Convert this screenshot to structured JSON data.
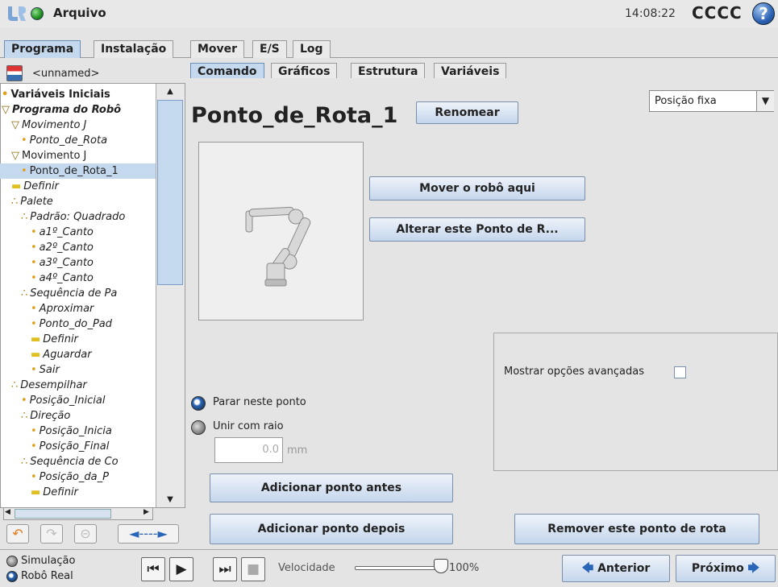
{
  "topbar": {
    "app_title": "Arquivo",
    "clock": "14:08:22",
    "robot_name": "CCCC",
    "help": "?"
  },
  "main_tabs": [
    "Programa",
    "Instalação",
    "Mover",
    "E/S",
    "Log"
  ],
  "sub_tabs": [
    "Comando",
    "Gráficos",
    "Estrutura",
    "Variáveis"
  ],
  "file": {
    "name": "<unnamed>"
  },
  "tree": [
    {
      "label": "Variáveis Iniciais",
      "style": "bold",
      "indent": 0,
      "marker": "•"
    },
    {
      "label": "Programa do Robô",
      "style": "bold-ital",
      "indent": 0,
      "marker": "▽"
    },
    {
      "label": "Movimento J",
      "style": "ital",
      "indent": 1,
      "marker": "▽"
    },
    {
      "label": "Ponto_de_Rota",
      "style": "ital",
      "indent": 2,
      "marker": "•"
    },
    {
      "label": "Movimento J",
      "style": "",
      "indent": 1,
      "marker": "▽"
    },
    {
      "label": "Ponto_de_Rota_1",
      "style": "sel",
      "indent": 2,
      "marker": "•"
    },
    {
      "label": "Definir",
      "style": "ital",
      "indent": 1,
      "marker": "▬"
    },
    {
      "label": "Palete",
      "style": "ital",
      "indent": 1,
      "marker": "∴"
    },
    {
      "label": "Padrão: Quadrado",
      "style": "ital",
      "indent": 2,
      "marker": "∴"
    },
    {
      "label": "a1º_Canto",
      "style": "ital",
      "indent": 3,
      "marker": "•"
    },
    {
      "label": "a2º_Canto",
      "style": "ital",
      "indent": 3,
      "marker": "•"
    },
    {
      "label": "a3º_Canto",
      "style": "ital",
      "indent": 3,
      "marker": "•"
    },
    {
      "label": "a4º_Canto",
      "style": "ital",
      "indent": 3,
      "marker": "•"
    },
    {
      "label": "Sequência de Pa",
      "style": "ital",
      "indent": 2,
      "marker": "∴"
    },
    {
      "label": "Aproximar",
      "style": "ital",
      "indent": 3,
      "marker": "•"
    },
    {
      "label": "Ponto_do_Pad",
      "style": "ital",
      "indent": 3,
      "marker": "•"
    },
    {
      "label": "Definir",
      "style": "ital",
      "indent": 3,
      "marker": "▬"
    },
    {
      "label": "Aguardar",
      "style": "ital",
      "indent": 3,
      "marker": "▬"
    },
    {
      "label": "Sair",
      "style": "ital",
      "indent": 3,
      "marker": "•"
    },
    {
      "label": "Desempilhar",
      "style": "ital",
      "indent": 1,
      "marker": "∴"
    },
    {
      "label": "Posição_Inicial",
      "style": "ital",
      "indent": 2,
      "marker": "•"
    },
    {
      "label": "Direção",
      "style": "ital",
      "indent": 2,
      "marker": "∴"
    },
    {
      "label": "Posição_Inicia",
      "style": "ital",
      "indent": 3,
      "marker": "•"
    },
    {
      "label": "Posição_Final",
      "style": "ital",
      "indent": 3,
      "marker": "•"
    },
    {
      "label": "Sequência de Co",
      "style": "ital",
      "indent": 2,
      "marker": "∴"
    },
    {
      "label": "Posição_da_P",
      "style": "ital",
      "indent": 3,
      "marker": "•"
    },
    {
      "label": "Definir",
      "style": "ital",
      "indent": 3,
      "marker": "▬"
    }
  ],
  "waypoint": {
    "title": "Ponto_de_Rota_1",
    "rename_label": "Renomear",
    "position_select": "Posição fixa",
    "move_here_label": "Mover o robô aqui",
    "change_point_label": "Alterar este Ponto de R...",
    "advanced_label": "Mostrar opções avançadas",
    "stop_label": "Parar neste ponto",
    "blend_label": "Unir com raio",
    "radius_value": "0.0",
    "radius_unit": "mm",
    "add_before_label": "Adicionar ponto antes",
    "add_after_label": "Adicionar ponto depois",
    "remove_label": "Remover este ponto de rota"
  },
  "bottom": {
    "sim_label": "Simulação",
    "real_label": "Robô Real",
    "speed_label": "Velocidade",
    "speed_value": "100%",
    "speed_fraction": 1.0,
    "prev_label": "Anterior",
    "next_label": "Próximo"
  }
}
